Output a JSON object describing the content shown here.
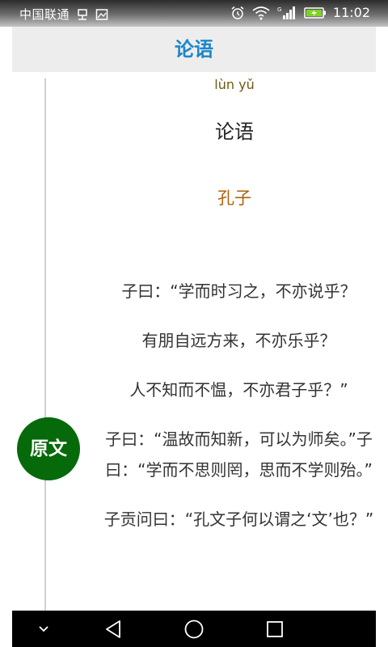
{
  "status_bar": {
    "carrier": "中国联通",
    "time": "11:02",
    "network_label": "G"
  },
  "header": {
    "title": "论语"
  },
  "work": {
    "pinyin": "lùn yǔ",
    "title": "论语",
    "author": "孔子"
  },
  "section": {
    "label": "原文"
  },
  "original_text": {
    "lines": [
      "子曰：“学而时习之，不亦说乎？",
      "有朋自远方来，不亦乐乎？",
      "人不知而不愠，不亦君子乎？”",
      "子曰：“温故而知新，可以为师矣。”子曰：“学而不思则罔，思而不学则殆。”",
      "子贡问曰：“孔文子何以谓之‘文’也？”"
    ]
  },
  "colors": {
    "title_blue": "#1b87c9",
    "author_orange": "#b16008",
    "badge_green": "#066a0a",
    "battery_green": "#7ed321"
  },
  "icons": {
    "status": [
      "usb-icon",
      "image-icon",
      "alarm-icon",
      "wifi-icon",
      "signal-icon",
      "battery-charging-icon"
    ],
    "nav": [
      "chevron-down-icon",
      "back-icon",
      "home-icon",
      "recents-icon"
    ]
  }
}
